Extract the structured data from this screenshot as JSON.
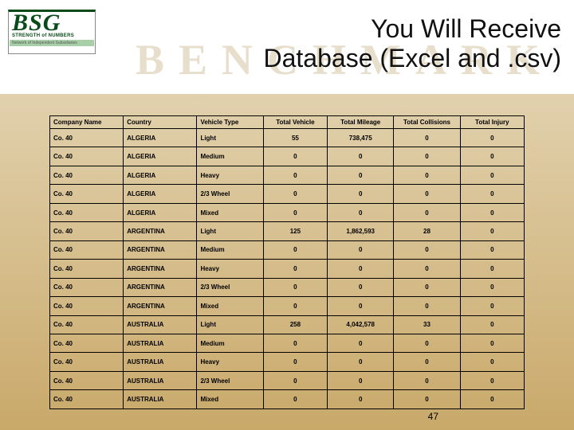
{
  "logo": {
    "main": "BSG",
    "sub1": "STRENGTH of NUMBERS",
    "sub2": "Network of Independent Subsidiaries"
  },
  "title": {
    "line1": "You Will Receive",
    "line2": "Database (Excel and .csv)",
    "watermark": "BENCHMARK"
  },
  "headers": [
    "Company Name",
    "Country",
    "Vehicle Type",
    "Total Vehicle",
    "Total Mileage",
    "Total Collisions",
    "Total Injury"
  ],
  "rows": [
    [
      "Co. 40",
      "ALGERIA",
      "Light",
      "55",
      "738,475",
      "0",
      "0"
    ],
    [
      "Co. 40",
      "ALGERIA",
      "Medium",
      "0",
      "0",
      "0",
      "0"
    ],
    [
      "Co. 40",
      "ALGERIA",
      "Heavy",
      "0",
      "0",
      "0",
      "0"
    ],
    [
      "Co. 40",
      "ALGERIA",
      "2/3 Wheel",
      "0",
      "0",
      "0",
      "0"
    ],
    [
      "Co. 40",
      "ALGERIA",
      "Mixed",
      "0",
      "0",
      "0",
      "0"
    ],
    [
      "Co. 40",
      "ARGENTINA",
      "Light",
      "125",
      "1,862,593",
      "28",
      "0"
    ],
    [
      "Co. 40",
      "ARGENTINA",
      "Medium",
      "0",
      "0",
      "0",
      "0"
    ],
    [
      "Co. 40",
      "ARGENTINA",
      "Heavy",
      "0",
      "0",
      "0",
      "0"
    ],
    [
      "Co. 40",
      "ARGENTINA",
      "2/3 Wheel",
      "0",
      "0",
      "0",
      "0"
    ],
    [
      "Co. 40",
      "ARGENTINA",
      "Mixed",
      "0",
      "0",
      "0",
      "0"
    ],
    [
      "Co. 40",
      "AUSTRALIA",
      "Light",
      "258",
      "4,042,578",
      "33",
      "0"
    ],
    [
      "Co. 40",
      "AUSTRALIA",
      "Medium",
      "0",
      "0",
      "0",
      "0"
    ],
    [
      "Co. 40",
      "AUSTRALIA",
      "Heavy",
      "0",
      "0",
      "0",
      "0"
    ],
    [
      "Co. 40",
      "AUSTRALIA",
      "2/3 Wheel",
      "0",
      "0",
      "0",
      "0"
    ],
    [
      "Co. 40",
      "AUSTRALIA",
      "Mixed",
      "0",
      "0",
      "0",
      "0"
    ]
  ],
  "page_number": "47",
  "chart_data": {
    "type": "table",
    "title": "You Will Receive Database (Excel and .csv)",
    "columns": [
      "Company Name",
      "Country",
      "Vehicle Type",
      "Total Vehicle",
      "Total Mileage",
      "Total Collisions",
      "Total Injury"
    ],
    "rows": [
      {
        "Company Name": "Co. 40",
        "Country": "ALGERIA",
        "Vehicle Type": "Light",
        "Total Vehicle": 55,
        "Total Mileage": 738475,
        "Total Collisions": 0,
        "Total Injury": 0
      },
      {
        "Company Name": "Co. 40",
        "Country": "ALGERIA",
        "Vehicle Type": "Medium",
        "Total Vehicle": 0,
        "Total Mileage": 0,
        "Total Collisions": 0,
        "Total Injury": 0
      },
      {
        "Company Name": "Co. 40",
        "Country": "ALGERIA",
        "Vehicle Type": "Heavy",
        "Total Vehicle": 0,
        "Total Mileage": 0,
        "Total Collisions": 0,
        "Total Injury": 0
      },
      {
        "Company Name": "Co. 40",
        "Country": "ALGERIA",
        "Vehicle Type": "2/3 Wheel",
        "Total Vehicle": 0,
        "Total Mileage": 0,
        "Total Collisions": 0,
        "Total Injury": 0
      },
      {
        "Company Name": "Co. 40",
        "Country": "ALGERIA",
        "Vehicle Type": "Mixed",
        "Total Vehicle": 0,
        "Total Mileage": 0,
        "Total Collisions": 0,
        "Total Injury": 0
      },
      {
        "Company Name": "Co. 40",
        "Country": "ARGENTINA",
        "Vehicle Type": "Light",
        "Total Vehicle": 125,
        "Total Mileage": 1862593,
        "Total Collisions": 28,
        "Total Injury": 0
      },
      {
        "Company Name": "Co. 40",
        "Country": "ARGENTINA",
        "Vehicle Type": "Medium",
        "Total Vehicle": 0,
        "Total Mileage": 0,
        "Total Collisions": 0,
        "Total Injury": 0
      },
      {
        "Company Name": "Co. 40",
        "Country": "ARGENTINA",
        "Vehicle Type": "Heavy",
        "Total Vehicle": 0,
        "Total Mileage": 0,
        "Total Collisions": 0,
        "Total Injury": 0
      },
      {
        "Company Name": "Co. 40",
        "Country": "ARGENTINA",
        "Vehicle Type": "2/3 Wheel",
        "Total Vehicle": 0,
        "Total Mileage": 0,
        "Total Collisions": 0,
        "Total Injury": 0
      },
      {
        "Company Name": "Co. 40",
        "Country": "ARGENTINA",
        "Vehicle Type": "Mixed",
        "Total Vehicle": 0,
        "Total Mileage": 0,
        "Total Collisions": 0,
        "Total Injury": 0
      },
      {
        "Company Name": "Co. 40",
        "Country": "AUSTRALIA",
        "Vehicle Type": "Light",
        "Total Vehicle": 258,
        "Total Mileage": 4042578,
        "Total Collisions": 33,
        "Total Injury": 0
      },
      {
        "Company Name": "Co. 40",
        "Country": "AUSTRALIA",
        "Vehicle Type": "Medium",
        "Total Vehicle": 0,
        "Total Mileage": 0,
        "Total Collisions": 0,
        "Total Injury": 0
      },
      {
        "Company Name": "Co. 40",
        "Country": "AUSTRALIA",
        "Vehicle Type": "Heavy",
        "Total Vehicle": 0,
        "Total Mileage": 0,
        "Total Collisions": 0,
        "Total Injury": 0
      },
      {
        "Company Name": "Co. 40",
        "Country": "AUSTRALIA",
        "Vehicle Type": "2/3 Wheel",
        "Total Vehicle": 0,
        "Total Mileage": 0,
        "Total Collisions": 0,
        "Total Injury": 0
      },
      {
        "Company Name": "Co. 40",
        "Country": "AUSTRALIA",
        "Vehicle Type": "Mixed",
        "Total Vehicle": 0,
        "Total Mileage": 0,
        "Total Collisions": 0,
        "Total Injury": 0
      }
    ]
  }
}
